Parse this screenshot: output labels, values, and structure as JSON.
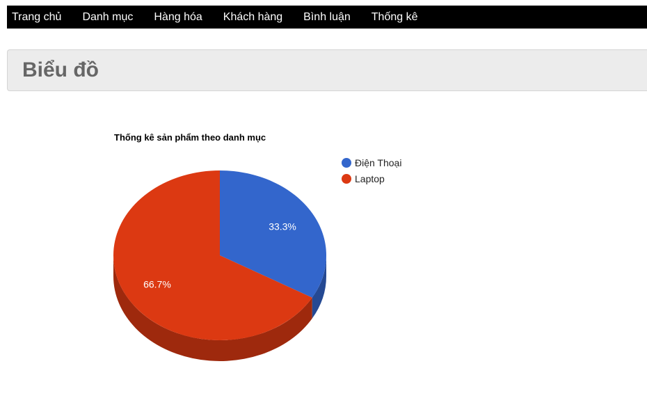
{
  "nav": {
    "items": [
      {
        "label": "Trang chủ"
      },
      {
        "label": "Danh mục"
      },
      {
        "label": "Hàng hóa"
      },
      {
        "label": "Khách hàng"
      },
      {
        "label": "Bình luận"
      },
      {
        "label": "Thống kê"
      }
    ]
  },
  "header": {
    "title": "Biểu đồ"
  },
  "colors": {
    "navbar_bg": "#000000",
    "header_bg": "#ececec",
    "series_phone": "#3366cc",
    "series_laptop": "#dc3912"
  },
  "chart_data": {
    "type": "pie",
    "style": "3d",
    "title": "Thống kê sản phẩm theo danh mục",
    "legend_position": "right",
    "slices": [
      {
        "label": "Điện Thoại",
        "percent": 33.3,
        "percent_label": "33.3%",
        "color": "#3366cc"
      },
      {
        "label": "Laptop",
        "percent": 66.7,
        "percent_label": "66.7%",
        "color": "#dc3912"
      }
    ]
  }
}
